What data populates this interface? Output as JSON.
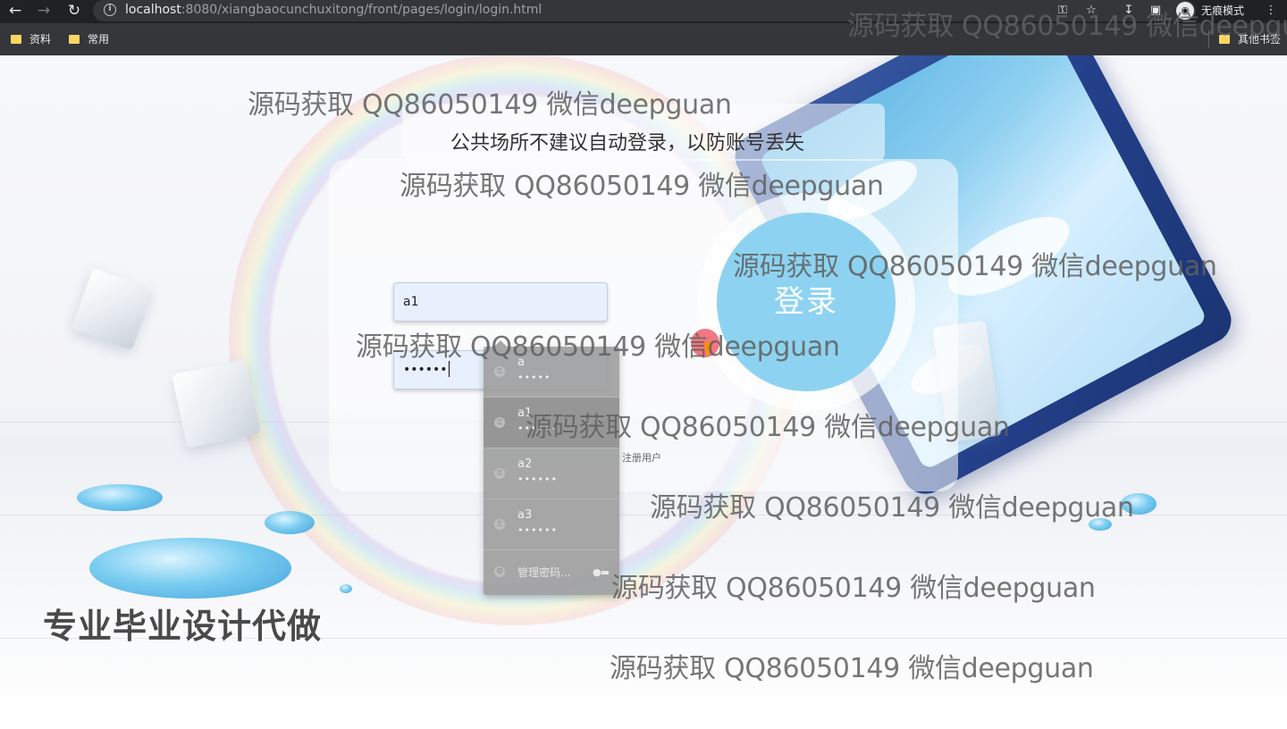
{
  "browser": {
    "url_host": "localhost",
    "url_rest": ":8080/xiangbaocunchuxitong/front/pages/login/login.html",
    "incognito_label": "无痕模式",
    "bookmarks": [
      {
        "label": "资料"
      },
      {
        "label": "常用"
      }
    ],
    "other_bookmarks": "其他书签"
  },
  "page": {
    "hint": "公共场所不建议自动登录，以防账号丢失",
    "username_value": "a1",
    "password_value": "••••••",
    "login_label": "登录",
    "register_link": "注册用户",
    "background_slogan": "专业毕业设计代做"
  },
  "autofill": {
    "items": [
      {
        "user": "a",
        "pass": "•••••"
      },
      {
        "user": "a1",
        "pass": "••••••"
      },
      {
        "user": "a2",
        "pass": "••••••"
      },
      {
        "user": "a3",
        "pass": "••••••"
      }
    ],
    "manage_label": "管理密码..."
  },
  "watermark": "源码获取 QQ86050149 微信deepguan"
}
